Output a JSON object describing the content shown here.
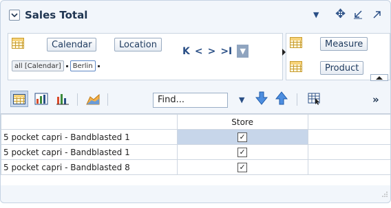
{
  "panel": {
    "title": "Sales Total",
    "icons": [
      "chevron-down-icon",
      "dropdown-arrow-icon",
      "move-icon",
      "minimize-icon",
      "maximize-icon"
    ]
  },
  "layout_left": {
    "buttons": [
      "Calendar",
      "Location"
    ],
    "filters": [
      "all [Calendar]",
      "Berlin"
    ]
  },
  "layout_right": {
    "buttons": [
      "Measure",
      "Product"
    ]
  },
  "toolbar": {
    "find_value": "Find..."
  },
  "table": {
    "column_header": "Store",
    "rows": [
      {
        "label": "5 pocket capri - Bandblasted 1",
        "checked": true
      },
      {
        "label": "5 pocket capri - Bandblasted 1",
        "checked": true
      },
      {
        "label": "5 pocket capri - Bandblasted 8",
        "checked": true
      }
    ]
  }
}
